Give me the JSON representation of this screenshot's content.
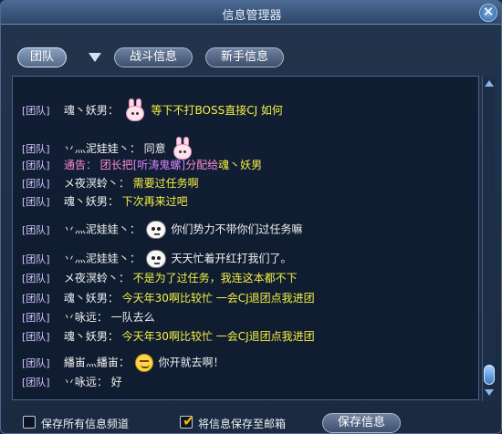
{
  "window": {
    "title": "信息管理器",
    "close_glyph": "✕"
  },
  "tabs": [
    {
      "label": "团队",
      "active": true
    },
    {
      "label": "战斗信息",
      "active": false
    },
    {
      "label": "新手信息",
      "active": false
    }
  ],
  "chat": {
    "messages": [
      {
        "channel": "[团队]",
        "sender": "魂丶妖男：",
        "emote": "rabbit-icon",
        "text": "等下不打BOSS直接CJ 如何",
        "text_color": "yellow"
      },
      {
        "channel": "[团队]",
        "sender": "丷灬泥娃娃丶：",
        "prefix": "同意",
        "emote": "rabbit-icon",
        "text": "",
        "text_color": "white"
      },
      {
        "channel": "[团队]",
        "sender": "通告：",
        "system": true,
        "text": "团长把",
        "item": "[听涛鬼螺]",
        "text2": "分配给",
        "target": "魂丶妖男"
      },
      {
        "channel": "[团队]",
        "sender": "メ夜溟蛉丶：",
        "text": "需要过任务啊",
        "text_color": "yellow"
      },
      {
        "channel": "[团队]",
        "sender": "魂丶妖男：",
        "text": "下次再来过吧",
        "text_color": "yellow"
      },
      {
        "channel": "[团队]",
        "sender": "丷灬泥娃娃丶：",
        "emote": "face-icon",
        "text": "你们势力不带你们过任务嘛",
        "text_color": "white"
      },
      {
        "channel": "[团队]",
        "sender": "丷灬泥娃娃丶：",
        "emote": "face-icon",
        "text": "天天忙着开红打我们了。",
        "text_color": "white"
      },
      {
        "channel": "[团队]",
        "sender": "メ夜溟蛉丶：",
        "text": "不是为了过任务，我连这本都不下",
        "text_color": "yellow"
      },
      {
        "channel": "[团队]",
        "sender": "魂丶妖男：",
        "text": "今天年30啊比较忙 一会CJ退团点我进团",
        "text_color": "yellow"
      },
      {
        "channel": "[团队]",
        "sender": "丷咏远：",
        "text": "一队去么",
        "text_color": "white"
      },
      {
        "channel": "[团队]",
        "sender": "魂丶妖男：",
        "text": "今天年30啊比较忙 一会CJ退团点我进团",
        "text_color": "yellow"
      },
      {
        "channel": "[团队]",
        "sender": "繙峀灬繙峀：",
        "emote": "smile-icon",
        "text": "你开就去啊！",
        "text_color": "white"
      },
      {
        "channel": "[团队]",
        "sender": "丷咏远：",
        "text": "好",
        "text_color": "white"
      }
    ]
  },
  "footer": {
    "save_all_label": "保存所有信息频道",
    "save_all_checked": false,
    "save_mail_label": "将信息保存至邮箱",
    "save_mail_checked": true,
    "save_button": "保存信息"
  },
  "colors": {
    "channel": "#d6c6ff",
    "yellow_text": "#f4ef44",
    "item": "#d885ff"
  }
}
